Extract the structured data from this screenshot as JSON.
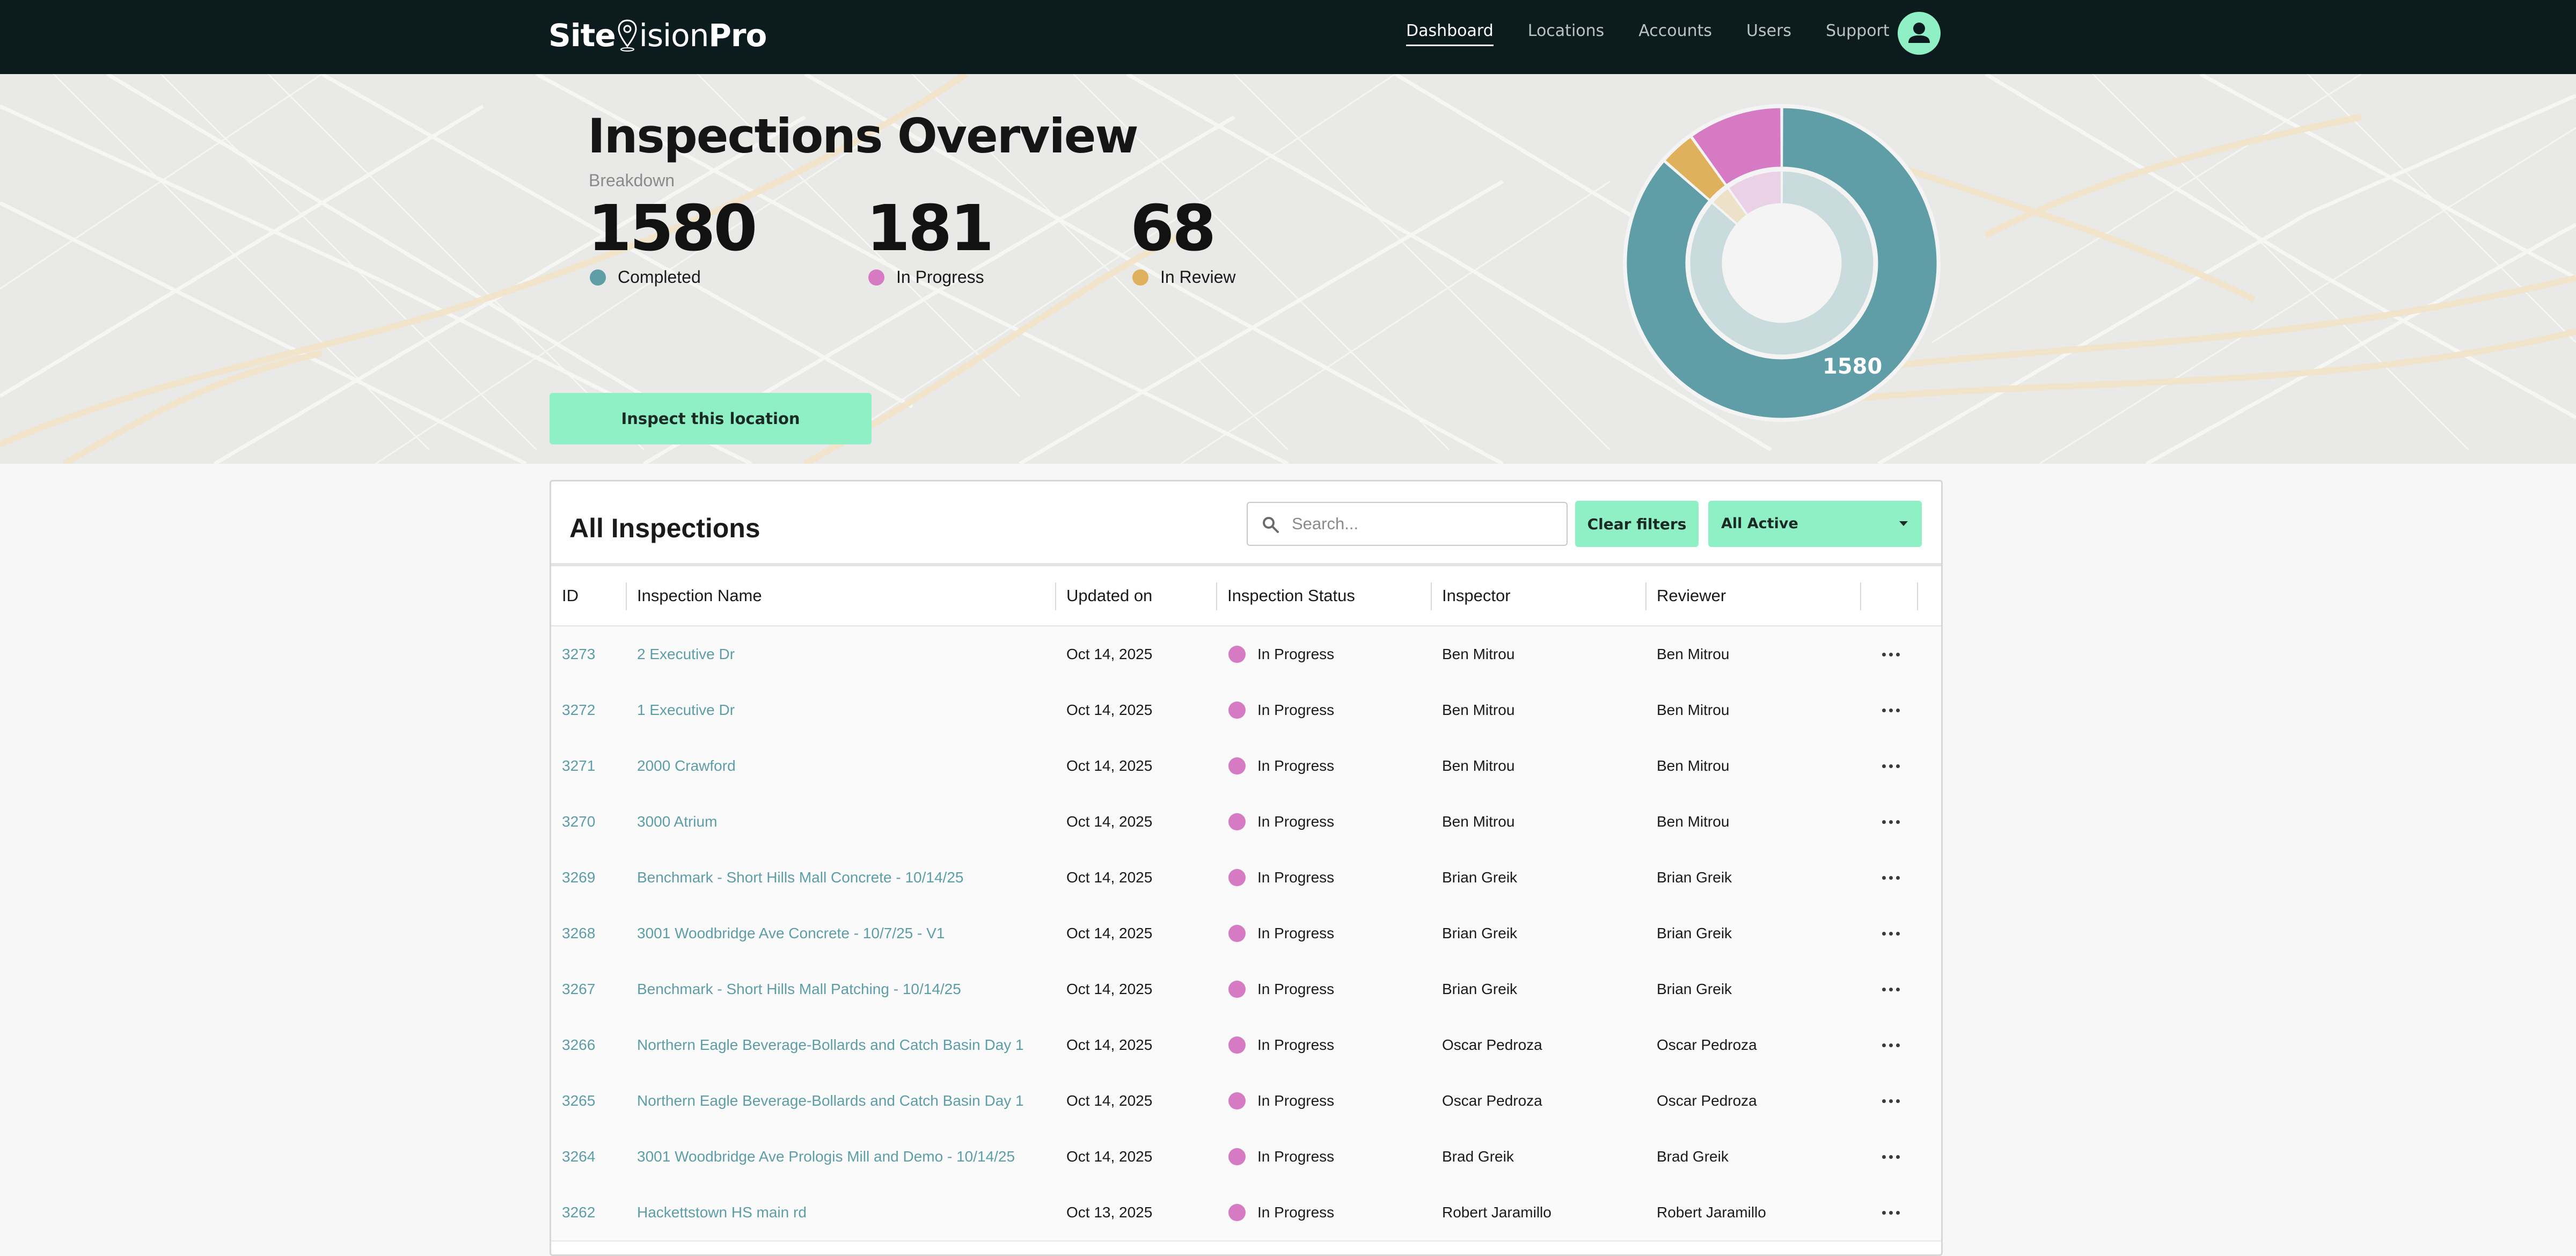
{
  "brand": {
    "logo_left": "Site",
    "logo_mid": "ision",
    "logo_right": "Pro"
  },
  "nav": {
    "items": [
      {
        "label": "Dashboard",
        "active": true
      },
      {
        "label": "Locations",
        "active": false
      },
      {
        "label": "Accounts",
        "active": false
      },
      {
        "label": "Users",
        "active": false
      },
      {
        "label": "Support",
        "active": false
      }
    ],
    "avatar_icon": "user-icon"
  },
  "overview": {
    "title": "Inspections Overview",
    "subtitle": "Breakdown",
    "stats": [
      {
        "value": "1580",
        "label": "Completed",
        "color": "#5f9ea7"
      },
      {
        "value": "181",
        "label": "In Progress",
        "color": "#d67ac3"
      },
      {
        "value": "68",
        "label": "In Review",
        "color": "#e0b15c"
      }
    ],
    "action_label": "Inspect this location",
    "donut_label": "1580"
  },
  "chart_data": {
    "type": "pie",
    "categories": [
      "Completed",
      "In Progress",
      "In Review"
    ],
    "values": [
      1580,
      181,
      68
    ],
    "colors": [
      "#5f9ea7",
      "#d67ac3",
      "#e0b15c"
    ]
  },
  "table": {
    "title": "All Inspections",
    "search_placeholder": "Search...",
    "search_icon": "search-icon",
    "clear_label": "Clear filters",
    "filter_value": "All Active",
    "columns": [
      "ID",
      "Inspection Name",
      "Updated on",
      "Inspection Status",
      "Inspector",
      "Reviewer"
    ],
    "status_color": "#d67ac3",
    "rows": [
      {
        "id": "3273",
        "name": "2 Executive Dr",
        "updated": "Oct 14, 2025",
        "status": "In Progress",
        "inspector": "Ben Mitrou",
        "reviewer": "Ben Mitrou"
      },
      {
        "id": "3272",
        "name": "1 Executive Dr",
        "updated": "Oct 14, 2025",
        "status": "In Progress",
        "inspector": "Ben Mitrou",
        "reviewer": "Ben Mitrou"
      },
      {
        "id": "3271",
        "name": "2000 Crawford",
        "updated": "Oct 14, 2025",
        "status": "In Progress",
        "inspector": "Ben Mitrou",
        "reviewer": "Ben Mitrou"
      },
      {
        "id": "3270",
        "name": "3000 Atrium",
        "updated": "Oct 14, 2025",
        "status": "In Progress",
        "inspector": "Ben Mitrou",
        "reviewer": "Ben Mitrou"
      },
      {
        "id": "3269",
        "name": "Benchmark - Short Hills Mall Concrete - 10/14/25",
        "updated": "Oct 14, 2025",
        "status": "In Progress",
        "inspector": "Brian Greik",
        "reviewer": "Brian Greik"
      },
      {
        "id": "3268",
        "name": "3001 Woodbridge Ave Concrete - 10/7/25 - V1",
        "updated": "Oct 14, 2025",
        "status": "In Progress",
        "inspector": "Brian Greik",
        "reviewer": "Brian Greik"
      },
      {
        "id": "3267",
        "name": "Benchmark - Short Hills Mall Patching - 10/14/25",
        "updated": "Oct 14, 2025",
        "status": "In Progress",
        "inspector": "Brian Greik",
        "reviewer": "Brian Greik"
      },
      {
        "id": "3266",
        "name": "Northern Eagle Beverage-Bollards and Catch Basin Day 1",
        "updated": "Oct 14, 2025",
        "status": "In Progress",
        "inspector": "Oscar Pedroza",
        "reviewer": "Oscar Pedroza"
      },
      {
        "id": "3265",
        "name": "Northern Eagle Beverage-Bollards and Catch Basin Day 1",
        "updated": "Oct 14, 2025",
        "status": "In Progress",
        "inspector": "Oscar Pedroza",
        "reviewer": "Oscar Pedroza"
      },
      {
        "id": "3264",
        "name": "3001 Woodbridge Ave Prologis Mill and Demo - 10/14/25",
        "updated": "Oct 14, 2025",
        "status": "In Progress",
        "inspector": "Brad Greik",
        "reviewer": "Brad Greik"
      },
      {
        "id": "3262",
        "name": "Hackettstown HS main rd",
        "updated": "Oct 13, 2025",
        "status": "In Progress",
        "inspector": "Robert Jaramillo",
        "reviewer": "Robert Jaramillo"
      }
    ]
  }
}
